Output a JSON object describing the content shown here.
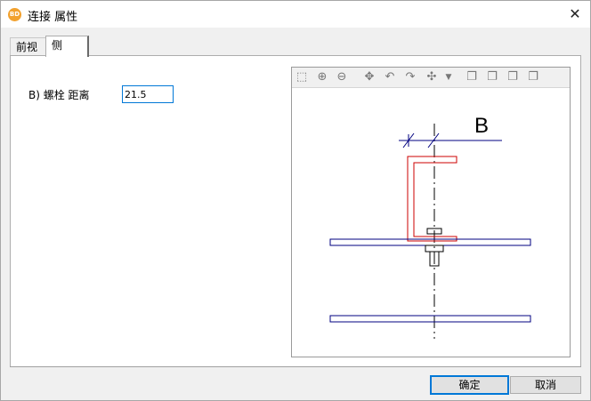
{
  "window": {
    "title": "连接 属性",
    "app_icon_text": "BD",
    "close_glyph": "✕"
  },
  "tabs": [
    {
      "label": "前视",
      "selected": false
    },
    {
      "label": "侧",
      "selected": true
    }
  ],
  "form": {
    "bolt_distance_label": "B) 螺栓 距离",
    "bolt_distance_value": "21.5"
  },
  "preview": {
    "toolbar_icons": [
      "fit-view-icon",
      "zoom-in-icon",
      "zoom-out-icon",
      "pan-icon",
      "rotate-left-icon",
      "rotate-right-icon",
      "point-icon",
      "dropdown-arrow-icon",
      "view-front-icon",
      "view-side-icon",
      "view-top-icon",
      "view-iso-icon"
    ],
    "dimension_label": "B",
    "colors": {
      "profile": "#cc0000",
      "plates": "#000080",
      "dimension": "#000080",
      "centerline": "#000000"
    }
  },
  "buttons": {
    "ok": "确定",
    "cancel": "取消"
  }
}
